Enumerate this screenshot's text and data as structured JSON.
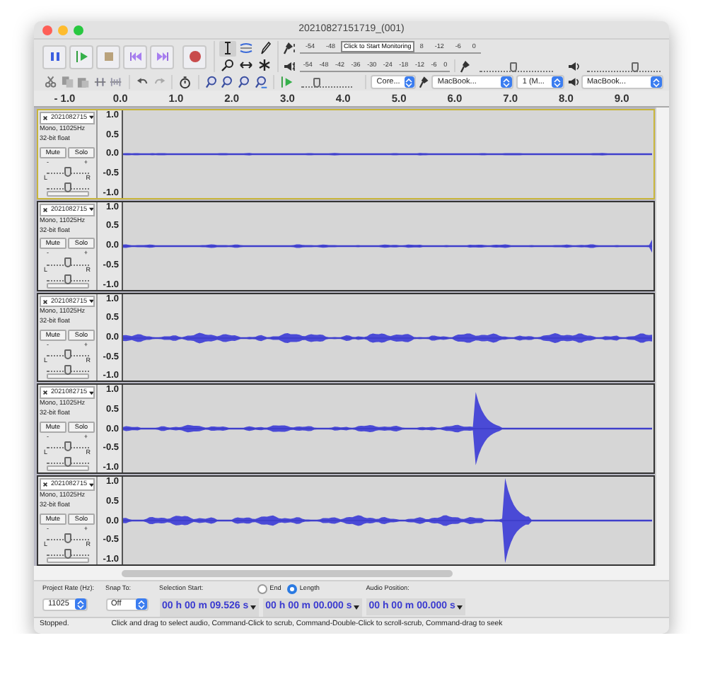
{
  "window": {
    "title": "20210827151719_(001)"
  },
  "meters": {
    "record": {
      "scale_before": [
        "-54",
        "-48"
      ],
      "button": "Click to Start Monitoring",
      "scale_after": [
        "8",
        "-12",
        "-6",
        "0"
      ]
    },
    "playback": {
      "scale": [
        "-54",
        "-48",
        "-42",
        "-36",
        "-30",
        "-24",
        "-18",
        "-12",
        "-6",
        "0"
      ]
    }
  },
  "mixer": {
    "record": {
      "level": 0.45
    },
    "playback": {
      "level": 0.65
    }
  },
  "play_at_speed": {
    "level": 0.3
  },
  "devices": [
    {
      "kind": "host",
      "value": "Core..."
    },
    {
      "kind": "input",
      "value": "MacBook..."
    },
    {
      "kind": "channels",
      "value": "1 (M..."
    },
    {
      "kind": "output",
      "value": "MacBook..."
    }
  ],
  "ruler": [
    "- 1.0",
    "0.0",
    "1.0",
    "2.0",
    "3.0",
    "4.0",
    "5.0",
    "6.0",
    "7.0",
    "8.0",
    "9.0"
  ],
  "tracks": [
    {
      "name": "2021082715",
      "format": "Mono, 11025Hz",
      "sample": "32-bit float",
      "mute": "Mute",
      "solo": "Solo",
      "selected": true,
      "gain_labels": [
        "-",
        "+"
      ],
      "gain": {
        "level": 0.5
      },
      "pan_labels": [
        "L",
        "R"
      ],
      "pan": {
        "level": 0.5
      },
      "scale": [
        "1.0",
        "0.5",
        "0.0",
        "-0.5",
        "-1.0"
      ]
    },
    {
      "name": "2021082715",
      "format": "Mono, 11025Hz",
      "sample": "32-bit float",
      "mute": "Mute",
      "solo": "Solo",
      "selected": false,
      "gain_labels": [
        "-",
        "+"
      ],
      "gain": {
        "level": 0.5
      },
      "pan_labels": [
        "L",
        "R"
      ],
      "pan": {
        "level": 0.5
      },
      "scale": [
        "1.0",
        "0.5",
        "0.0",
        "-0.5",
        "-1.0"
      ]
    },
    {
      "name": "2021082715",
      "format": "Mono, 11025Hz",
      "sample": "32-bit float",
      "mute": "Mute",
      "solo": "Solo",
      "selected": false,
      "gain_labels": [
        "-",
        "+"
      ],
      "gain": {
        "level": 0.5
      },
      "pan_labels": [
        "L",
        "R"
      ],
      "pan": {
        "level": 0.5
      },
      "scale": [
        "1.0",
        "0.5",
        "0.0",
        "-0.5",
        "-1.0"
      ]
    },
    {
      "name": "2021082715",
      "format": "Mono, 11025Hz",
      "sample": "32-bit float",
      "mute": "Mute",
      "solo": "Solo",
      "selected": false,
      "gain_labels": [
        "-",
        "+"
      ],
      "gain": {
        "level": 0.5
      },
      "pan_labels": [
        "L",
        "R"
      ],
      "pan": {
        "level": 0.5
      },
      "scale": [
        "1.0",
        "0.5",
        "0.0",
        "-0.5",
        "-1.0"
      ]
    },
    {
      "name": "2021082715",
      "format": "Mono, 11025Hz",
      "sample": "32-bit float",
      "mute": "Mute",
      "solo": "Solo",
      "selected": false,
      "gain_labels": [
        "-",
        "+"
      ],
      "gain": {
        "level": 0.5
      },
      "pan_labels": [
        "L",
        "R"
      ],
      "pan": {
        "level": 0.5
      },
      "scale": [
        "1.0",
        "0.5",
        "0.0",
        "-0.5",
        "-1.0"
      ]
    }
  ],
  "selection_bar": {
    "project_rate": {
      "label": "Project Rate (Hz):",
      "value": "11025"
    },
    "snap": {
      "label": "Snap To:",
      "value": "Off"
    },
    "selection": {
      "label": "Selection Start:",
      "start": "00 h 00 m 09.526 s",
      "options": [
        {
          "label": "End",
          "selected": false
        },
        {
          "label": "Length",
          "selected": true
        }
      ],
      "length": "00 h 00 m 00.000 s"
    },
    "audio_position": {
      "label": "Audio Position:",
      "value": "00 h 00 m 00.000 s"
    }
  },
  "status_bar": {
    "state": "Stopped.",
    "hint": "Click and drag to select audio, Command-Click to scrub, Command-Double-Click to scroll-scrub, Command-drag to seek"
  }
}
